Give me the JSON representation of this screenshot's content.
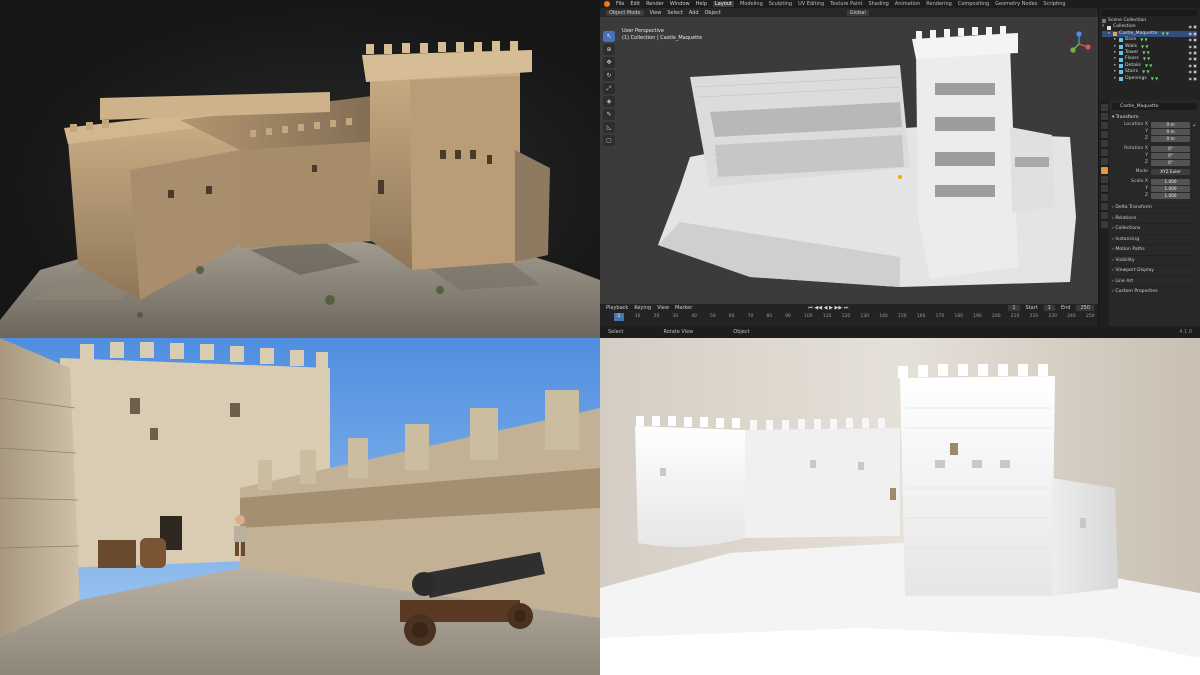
{
  "blender": {
    "topbar": {
      "menus": [
        "File",
        "Edit",
        "Render",
        "Window",
        "Help"
      ],
      "workspaces": [
        "Layout",
        "Modeling",
        "Sculpting",
        "UV Editing",
        "Texture Paint",
        "Shading",
        "Animation",
        "Rendering",
        "Compositing",
        "Geometry Nodes",
        "Scripting"
      ],
      "active_workspace": "Layout"
    },
    "viewport_header": {
      "mode": "Object Mode",
      "menus": [
        "View",
        "Select",
        "Add",
        "Object"
      ],
      "orientation": "Global"
    },
    "viewport": {
      "view_name": "User Perspective",
      "collection_path": "(1) Collection | Castle_Maquette"
    },
    "toolbar_icons": [
      "cursor-tool",
      "cursor-3d",
      "move-tool",
      "rotate-tool",
      "scale-tool",
      "transform-tool",
      "annotate-tool",
      "measure-tool",
      "add-cube-tool"
    ],
    "outliner": {
      "scene_collection": "Scene Collection",
      "collection": "Collection",
      "items": [
        {
          "name": "Castle_Maquette",
          "selected": true
        },
        {
          "name": "Base",
          "selected": false
        },
        {
          "name": "Walls",
          "selected": false
        },
        {
          "name": "Tower",
          "selected": false
        },
        {
          "name": "Floors",
          "selected": false
        },
        {
          "name": "Details",
          "selected": false
        },
        {
          "name": "Stairs",
          "selected": false
        },
        {
          "name": "Openings",
          "selected": false
        }
      ]
    },
    "properties": {
      "object_name": "Castle_Maquette",
      "transform_label": "Transform",
      "location": {
        "label_x": "Location X",
        "label_y": "Y",
        "label_z": "Z",
        "x": "0 m",
        "y": "0 m",
        "z": "0 m"
      },
      "rotation": {
        "label_x": "Rotation X",
        "label_y": "Y",
        "label_z": "Z",
        "x": "0°",
        "y": "0°",
        "z": "0°"
      },
      "mode_label": "Mode",
      "mode_value": "XYZ Euler",
      "scale": {
        "label_x": "Scale X",
        "label_y": "Y",
        "label_z": "Z",
        "x": "1.000",
        "y": "1.000",
        "z": "1.000"
      },
      "sections": [
        "Delta Transform",
        "Relations",
        "Collections",
        "Instancing",
        "Motion Paths",
        "Visibility",
        "Viewport Display",
        "Line Art",
        "Custom Properties"
      ]
    },
    "timeline": {
      "menus": [
        "Playback",
        "Keying",
        "View",
        "Marker"
      ],
      "current_frame": "1",
      "start_label": "Start",
      "start": "1",
      "end_label": "End",
      "end": "250",
      "ruler": [
        "0",
        "10",
        "20",
        "30",
        "40",
        "50",
        "60",
        "70",
        "80",
        "90",
        "100",
        "110",
        "120",
        "130",
        "140",
        "150",
        "160",
        "170",
        "180",
        "190",
        "200",
        "210",
        "220",
        "230",
        "240",
        "250"
      ]
    },
    "statusbar": {
      "select": "Select",
      "rotate_view": "Rotate View",
      "object": "Object",
      "version": "4.1.0"
    },
    "colors": {
      "accent": "#4772b3",
      "orange": "#e87d0d",
      "selection": "#334d80"
    }
  },
  "panels": {
    "photogrammetry": "textured-castle-scan",
    "game_scene": "castle-courtyard-with-cannon",
    "printed_model": "white-3d-printed-castle-maquette"
  }
}
